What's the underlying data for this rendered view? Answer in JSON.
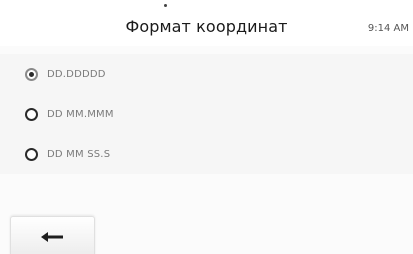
{
  "header": {
    "title": "Формат координат",
    "time": "9:14 AM"
  },
  "coordinate_formats": {
    "selected_index": 0,
    "items": [
      {
        "label": "DD.DDDDD"
      },
      {
        "label": "DD MM.MMM"
      },
      {
        "label": "DD MM SS.S"
      }
    ]
  },
  "footer": {
    "back_icon": "arrow-left-icon"
  }
}
